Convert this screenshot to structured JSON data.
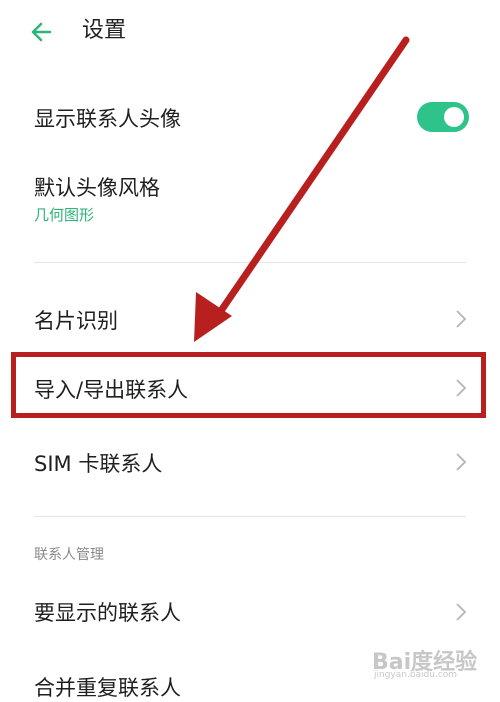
{
  "header": {
    "title": "设置"
  },
  "settings": {
    "show_avatar": {
      "label": "显示联系人头像",
      "enabled": true
    },
    "default_avatar_style": {
      "label": "默认头像风格",
      "value": "几何图形"
    },
    "business_card": {
      "label": "名片识别"
    },
    "import_export": {
      "label": "导入/导出联系人"
    },
    "sim_contacts": {
      "label": "SIM 卡联系人"
    }
  },
  "contacts_management": {
    "section_title": "联系人管理",
    "display_contacts": {
      "label": "要显示的联系人"
    },
    "merge_duplicates": {
      "label": "合并重复联系人"
    }
  },
  "watermark": {
    "text": "Bai度经验",
    "domain": "jingyan.baidu.com"
  },
  "colors": {
    "accent": "#2ec38a",
    "highlight": "#b82020"
  }
}
